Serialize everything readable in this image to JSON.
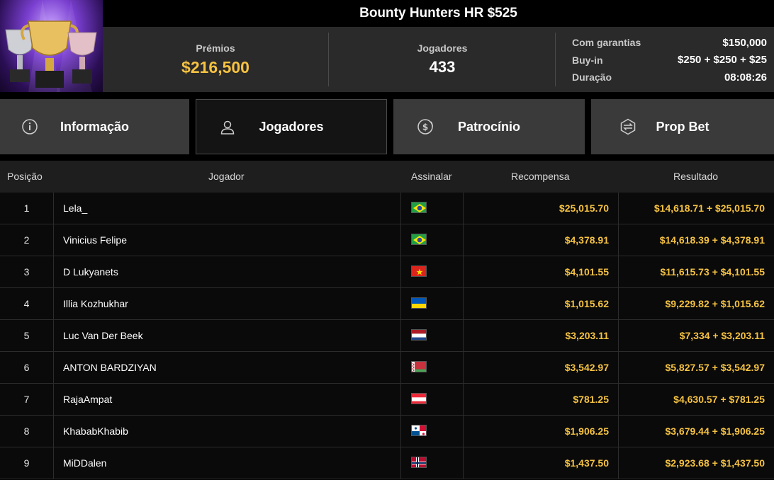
{
  "tournament": {
    "title": "Bounty Hunters HR $525",
    "prizes_label": "Prémios",
    "prizes_value": "$216,500",
    "players_label": "Jogadores",
    "players_value": "433",
    "details": [
      {
        "label": "Com garantias",
        "value": "$150,000"
      },
      {
        "label": "Buy-in",
        "value": "$250 + $250 + $25"
      },
      {
        "label": "Duração",
        "value": "08:08:26"
      }
    ]
  },
  "tabs": [
    {
      "label": "Informação",
      "icon": "info-icon",
      "active": false
    },
    {
      "label": "Jogadores",
      "icon": "user-icon",
      "active": true
    },
    {
      "label": "Patrocínio",
      "icon": "dollar-coin-icon",
      "active": false
    },
    {
      "label": "Prop Bet",
      "icon": "prop-bet-icon",
      "active": false
    }
  ],
  "table": {
    "headers": {
      "position": "Posição",
      "player": "Jogador",
      "flag": "Assinalar",
      "reward": "Recompensa",
      "result": "Resultado"
    },
    "rows": [
      {
        "pos": "1",
        "name": "Lela_",
        "flag": "brazil",
        "reward": "$25,015.70",
        "result": "$14,618.71 + $25,015.70"
      },
      {
        "pos": "2",
        "name": "Vinicius Felipe",
        "flag": "brazil",
        "reward": "$4,378.91",
        "result": "$14,618.39 + $4,378.91"
      },
      {
        "pos": "3",
        "name": "D Lukyanets",
        "flag": "vietnam",
        "reward": "$4,101.55",
        "result": "$11,615.73 + $4,101.55"
      },
      {
        "pos": "4",
        "name": "Illia Kozhukhar",
        "flag": "ukraine",
        "reward": "$1,015.62",
        "result": "$9,229.82 + $1,015.62"
      },
      {
        "pos": "5",
        "name": "Luc Van Der Beek",
        "flag": "netherlands",
        "reward": "$3,203.11",
        "result": "$7,334 + $3,203.11"
      },
      {
        "pos": "6",
        "name": "ANTON BARDZIYAN",
        "flag": "belarus",
        "reward": "$3,542.97",
        "result": "$5,827.57 + $3,542.97"
      },
      {
        "pos": "7",
        "name": "RajaAmpat",
        "flag": "austria",
        "reward": "$781.25",
        "result": "$4,630.57 + $781.25"
      },
      {
        "pos": "8",
        "name": "KhababKhabib",
        "flag": "panama",
        "reward": "$1,906.25",
        "result": "$3,679.44 + $1,906.25"
      },
      {
        "pos": "9",
        "name": "MiDDalen",
        "flag": "norway",
        "reward": "$1,437.50",
        "result": "$2,923.68 + $1,437.50"
      }
    ]
  },
  "colors": {
    "accent_gold": "#f5c242",
    "panel": "#2a2a2a",
    "tab": "#3a3a3a",
    "tab_active": "#141414"
  }
}
